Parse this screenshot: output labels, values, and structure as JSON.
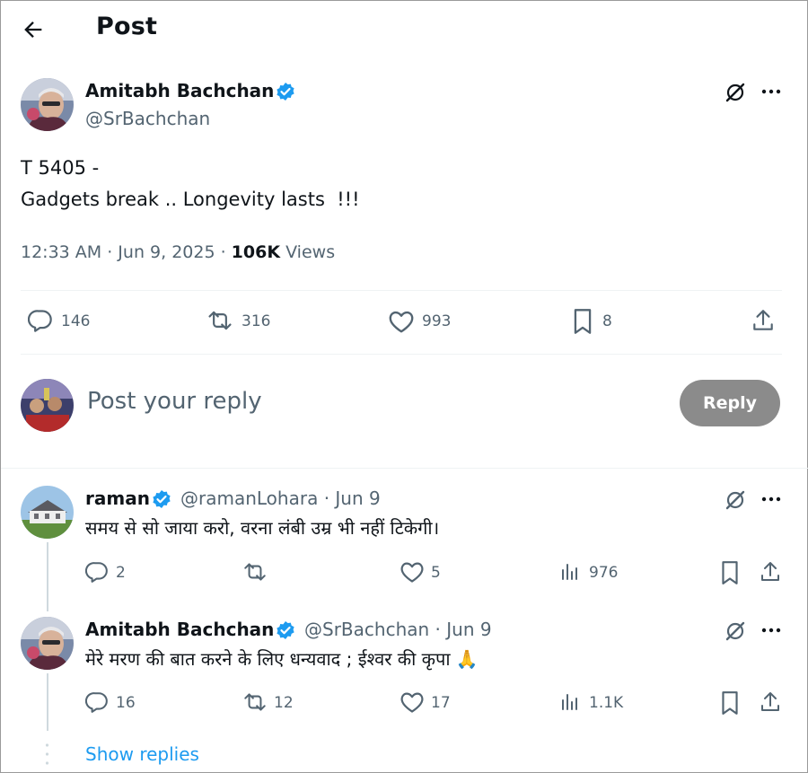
{
  "header": {
    "title": "Post"
  },
  "post": {
    "author_name": "Amitabh Bachchan",
    "author_handle": "@SrBachchan",
    "text_line1": "T 5405 -",
    "text_line2": "Gadgets break .. Longevity lasts  !!!",
    "timestamp": "12:33 AM · Jun 9, 2025 · ",
    "views_count": "106K",
    "views_label": " Views",
    "stats": {
      "replies": "146",
      "reposts": "316",
      "likes": "993",
      "bookmarks": "8"
    }
  },
  "composer": {
    "placeholder": "Post your reply",
    "button_label": "Reply"
  },
  "replies": [
    {
      "name": "raman",
      "handle_date": "@ramanLohara · Jun 9",
      "text": "समय से सो जाया करो, वरना लंबी उम्र भी नहीं टिकेगी।",
      "stats": {
        "replies": "2",
        "reposts": "",
        "likes": "5",
        "views": "976"
      }
    },
    {
      "name": "Amitabh Bachchan",
      "handle_date": "@SrBachchan · Jun 9",
      "text": "मेरे मरण की बात करने के लिए धन्यवाद ; ईश्वर  की कृपा 🙏",
      "stats": {
        "replies": "16",
        "reposts": "12",
        "likes": "17",
        "views": "1.1K"
      }
    }
  ],
  "show_replies": "Show replies",
  "colors": {
    "accent": "#1d9bf0",
    "muted": "#536471",
    "text": "#0f1419",
    "button_disabled": "#8b8b8b"
  },
  "icons": [
    "back-arrow-icon",
    "verified-badge-icon",
    "grok-icon",
    "more-icon",
    "reply-icon",
    "repost-icon",
    "like-icon",
    "bookmark-icon",
    "share-icon",
    "views-icon"
  ]
}
